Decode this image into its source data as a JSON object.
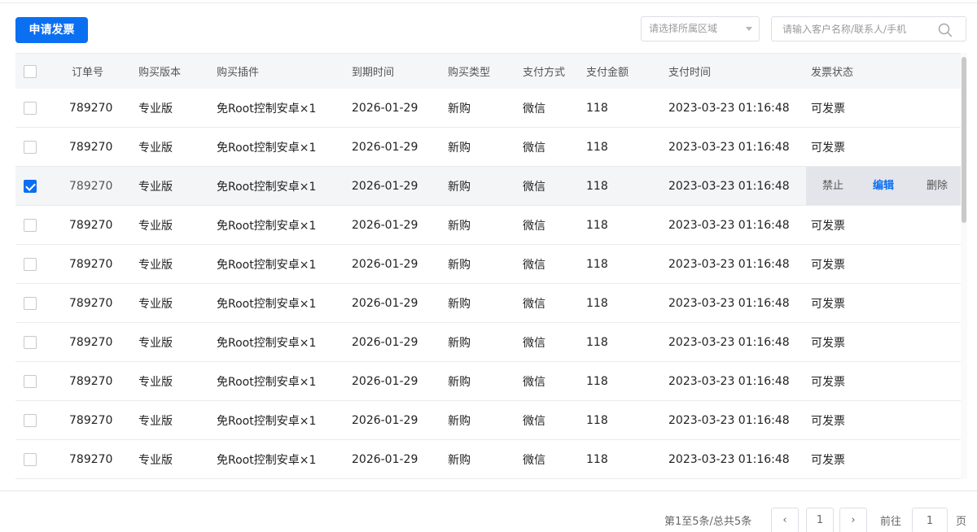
{
  "toolbar": {
    "apply_invoice_label": "申请发票",
    "region_placeholder": "请选择所属区域",
    "search_placeholder": "请输入客户名称/联系人/手机"
  },
  "table": {
    "headers": {
      "order_no": "订单号",
      "version": "购买版本",
      "plugin": "购买插件",
      "expire": "到期时间",
      "purchase_type": "购买类型",
      "pay_method": "支付方式",
      "amount": "支付金额",
      "pay_time": "支付时间",
      "invoice_status": "发票状态"
    },
    "rows": [
      {
        "order_no": "789270",
        "version": "专业版",
        "plugin": "免Root控制安卓×1",
        "expire": "2026-01-29",
        "purchase_type": "新购",
        "pay_method": "微信",
        "amount": "118",
        "pay_time": "2023-03-23 01:16:48",
        "invoice_status": "可发票"
      },
      {
        "order_no": "789270",
        "version": "专业版",
        "plugin": "免Root控制安卓×1",
        "expire": "2026-01-29",
        "purchase_type": "新购",
        "pay_method": "微信",
        "amount": "118",
        "pay_time": "2023-03-23 01:16:48",
        "invoice_status": "可发票"
      },
      {
        "order_no": "789270",
        "version": "专业版",
        "plugin": "免Root控制安卓×1",
        "expire": "2026-01-29",
        "purchase_type": "新购",
        "pay_method": "微信",
        "amount": "118",
        "pay_time": "2023-03-23 01:16:48",
        "invoice_status": "",
        "selected": true
      },
      {
        "order_no": "789270",
        "version": "专业版",
        "plugin": "免Root控制安卓×1",
        "expire": "2026-01-29",
        "purchase_type": "新购",
        "pay_method": "微信",
        "amount": "118",
        "pay_time": "2023-03-23 01:16:48",
        "invoice_status": "可发票"
      },
      {
        "order_no": "789270",
        "version": "专业版",
        "plugin": "免Root控制安卓×1",
        "expire": "2026-01-29",
        "purchase_type": "新购",
        "pay_method": "微信",
        "amount": "118",
        "pay_time": "2023-03-23 01:16:48",
        "invoice_status": "可发票"
      },
      {
        "order_no": "789270",
        "version": "专业版",
        "plugin": "免Root控制安卓×1",
        "expire": "2026-01-29",
        "purchase_type": "新购",
        "pay_method": "微信",
        "amount": "118",
        "pay_time": "2023-03-23 01:16:48",
        "invoice_status": "可发票"
      },
      {
        "order_no": "789270",
        "version": "专业版",
        "plugin": "免Root控制安卓×1",
        "expire": "2026-01-29",
        "purchase_type": "新购",
        "pay_method": "微信",
        "amount": "118",
        "pay_time": "2023-03-23 01:16:48",
        "invoice_status": "可发票"
      },
      {
        "order_no": "789270",
        "version": "专业版",
        "plugin": "免Root控制安卓×1",
        "expire": "2026-01-29",
        "purchase_type": "新购",
        "pay_method": "微信",
        "amount": "118",
        "pay_time": "2023-03-23 01:16:48",
        "invoice_status": "可发票"
      },
      {
        "order_no": "789270",
        "version": "专业版",
        "plugin": "免Root控制安卓×1",
        "expire": "2026-01-29",
        "purchase_type": "新购",
        "pay_method": "微信",
        "amount": "118",
        "pay_time": "2023-03-23 01:16:48",
        "invoice_status": "可发票"
      },
      {
        "order_no": "789270",
        "version": "专业版",
        "plugin": "免Root控制安卓×1",
        "expire": "2026-01-29",
        "purchase_type": "新购",
        "pay_method": "微信",
        "amount": "118",
        "pay_time": "2023-03-23 01:16:48",
        "invoice_status": "可发票"
      }
    ],
    "row_actions": {
      "disable": "禁止",
      "edit": "编辑",
      "delete": "删除"
    }
  },
  "pagination": {
    "summary": "第1至5条/总共5条",
    "prev_icon": "chevron-left-icon",
    "next_icon": "chevron-right-icon",
    "current_page": "1",
    "goto_label": "前往",
    "goto_value": "1",
    "page_label": "页"
  },
  "colors": {
    "accent": "#0b6ff2",
    "header_bg": "#f5f6f8",
    "selected_row_bg": "#f4f5f7",
    "action_panel_bg": "#e3e5ea"
  }
}
